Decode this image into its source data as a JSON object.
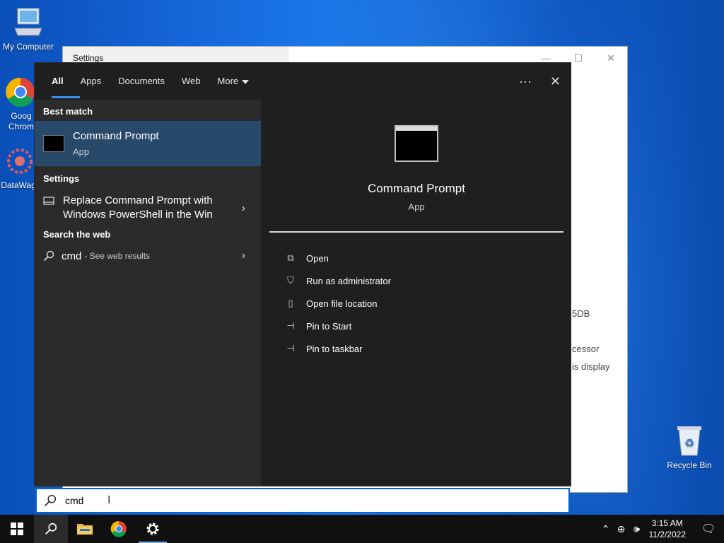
{
  "desktop": {
    "icons": [
      {
        "label": "My Computer"
      },
      {
        "label": "Goog Chrom"
      },
      {
        "label": "DataWag"
      },
      {
        "label": "Recycle Bin"
      }
    ]
  },
  "settings_window": {
    "title": "Settings",
    "fragments": [
      "5DB",
      "cessor",
      "is display"
    ]
  },
  "search": {
    "tabs": [
      {
        "label": "All",
        "active": true
      },
      {
        "label": "Apps"
      },
      {
        "label": "Documents"
      },
      {
        "label": "Web"
      },
      {
        "label": "More"
      }
    ],
    "more_icon": "ellipsis-icon",
    "close_icon": "close-icon",
    "best_match": {
      "heading": "Best match",
      "name": "Command Prompt",
      "type": "App"
    },
    "settings": {
      "heading": "Settings",
      "item_line1": "Replace Command Prompt with",
      "item_line2": "Windows PowerShell in the Win"
    },
    "web": {
      "heading": "Search the web",
      "query": "cmd",
      "hint": "- See web results"
    },
    "preview": {
      "name": "Command Prompt",
      "type": "App"
    },
    "actions": [
      {
        "label": "Open",
        "icon": "open-icon"
      },
      {
        "label": "Run as administrator",
        "icon": "shield-icon"
      },
      {
        "label": "Open file location",
        "icon": "file-location-icon"
      },
      {
        "label": "Pin to Start",
        "icon": "pin-icon"
      },
      {
        "label": "Pin to taskbar",
        "icon": "pin-icon"
      }
    ],
    "input_value": "cmd"
  },
  "taskbar": {
    "time": "3:15 AM",
    "date": "11/2/2022"
  },
  "colors": {
    "accent": "#0a63c9",
    "selected_row": "#29496a",
    "panel_dark": "#1f1f1f",
    "panel_left": "#2b2b2b"
  }
}
